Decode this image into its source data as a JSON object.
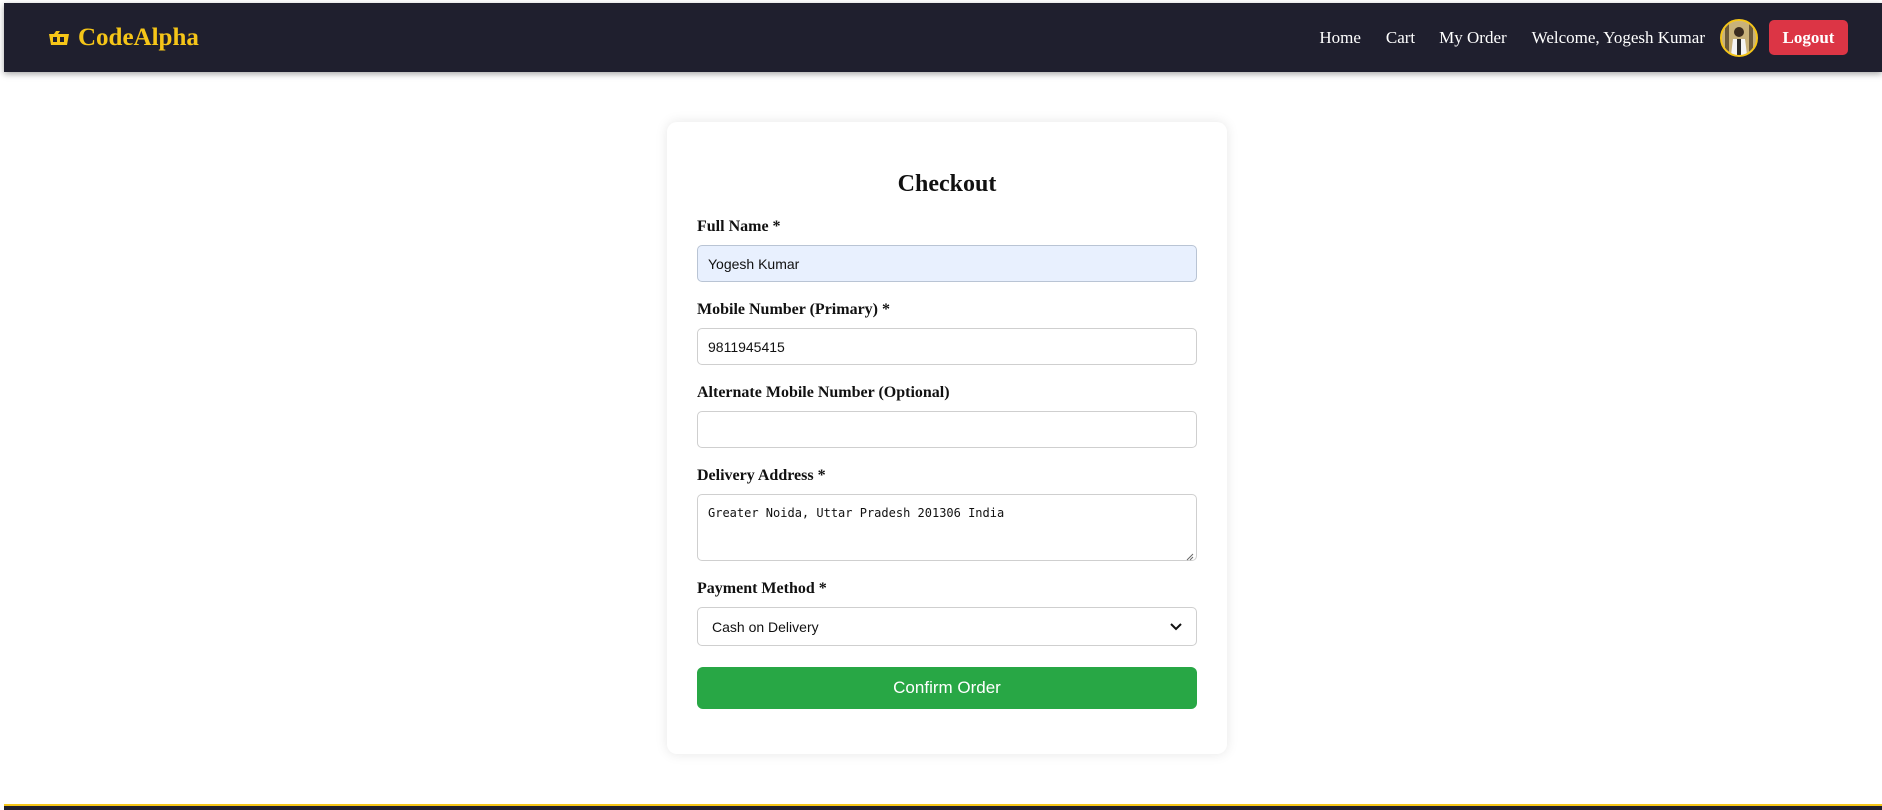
{
  "navbar": {
    "brand": "CodeAlpha",
    "links": {
      "home": "Home",
      "cart": "Cart",
      "my_order": "My Order"
    },
    "welcome": "Welcome, Yogesh Kumar",
    "logout": "Logout"
  },
  "checkout": {
    "title": "Checkout",
    "full_name": {
      "label": "Full Name *",
      "value": "Yogesh Kumar"
    },
    "mobile_primary": {
      "label": "Mobile Number (Primary) *",
      "value": "9811945415"
    },
    "mobile_alternate": {
      "label": "Alternate Mobile Number (Optional)",
      "value": ""
    },
    "address": {
      "label": "Delivery Address *",
      "value": "Greater Noida, Uttar Pradesh 201306 India"
    },
    "payment": {
      "label": "Payment Method *",
      "selected": "Cash on Delivery"
    },
    "confirm_button": "Confirm Order"
  },
  "colors": {
    "navbar_bg": "#1f1f2e",
    "brand": "#f5c518",
    "logout_bg": "#dc3545",
    "confirm_bg": "#28a745",
    "autofill_bg": "#e8f0fe"
  }
}
